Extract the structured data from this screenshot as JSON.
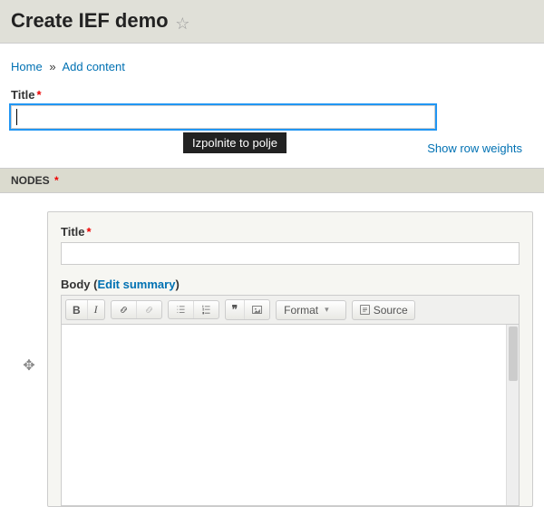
{
  "header": {
    "title": "Create IEF demo"
  },
  "breadcrumb": {
    "home": "Home",
    "add": "Add content"
  },
  "form": {
    "title_label": "Title",
    "title_value": "",
    "tooltip": "Izpolnite to polje",
    "show_weights": "Show row weights",
    "nodes_legend": "NODES"
  },
  "node": {
    "title_label": "Title",
    "title_value": "",
    "body_label": "Body",
    "edit_summary": "Edit summary"
  },
  "editor": {
    "format_label": "Format",
    "source_label": "Source"
  }
}
